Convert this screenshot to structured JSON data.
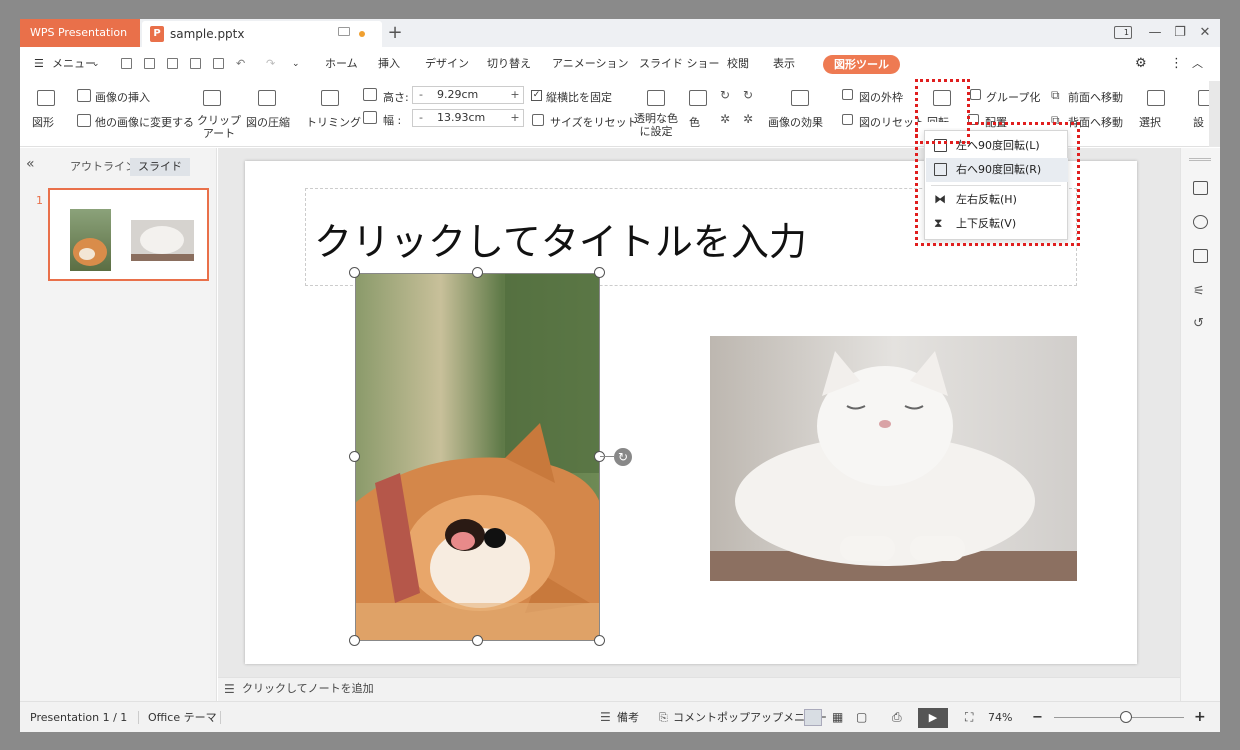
{
  "titlebar": {
    "app_tab": "WPS Presentation",
    "doc_tab": "sample.pptx",
    "new_tab": "+",
    "page_indicator": "1"
  },
  "menubar": {
    "menu": "メニュー",
    "tabs": [
      "ホーム",
      "挿入",
      "デザイン",
      "切り替え",
      "アニメーション",
      "スライド ショー",
      "校閲",
      "表示"
    ],
    "tool_tab": "図形ツール"
  },
  "ribbon": {
    "shape": "図形",
    "insert_image": "画像の挿入",
    "change_image": "他の画像に変更する",
    "clip_art": "クリップ\nアート",
    "compress": "図の圧縮",
    "trim": "トリミング",
    "height_label": "高さ:",
    "height_value": "9.29cm",
    "width_label": "幅 :",
    "width_value": "13.93cm",
    "lock_ratio": "縦横比を固定",
    "reset_size": "サイズをリセット",
    "transparent": "透明な色\nに設定",
    "color": "色",
    "effects": "画像の効果",
    "outline": "図の外枠",
    "reset_pic": "図のリセット",
    "rotate": "回転",
    "arrange": "配置",
    "group": "グループ化",
    "bring_front": "前面へ移動",
    "send_back": "背面へ移動",
    "select": "選択",
    "settings": "設"
  },
  "rotate_menu": {
    "items": [
      {
        "label": "左へ90度回転(L)"
      },
      {
        "label": "右へ90度回転(R)"
      },
      {
        "label": "左右反転(H)"
      },
      {
        "label": "上下反転(V)"
      }
    ]
  },
  "left_panel": {
    "tabs": [
      "アウトライン",
      "スライド"
    ],
    "slide_number": "1"
  },
  "slide": {
    "title": "クリックしてタイトルを入力"
  },
  "notes": {
    "placeholder": "クリックしてノートを追加"
  },
  "statusbar": {
    "presentation": "Presentation 1 / 1",
    "theme": "Office テーマ",
    "notes": "備考",
    "comment": "コメントポップアップメニュー",
    "zoom": "74%",
    "zoom_level": 0.55
  },
  "colors": {
    "accent": "#e9704a",
    "highlight_border": "#e01e1e"
  }
}
